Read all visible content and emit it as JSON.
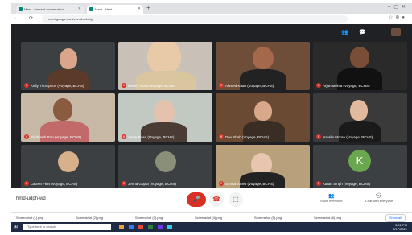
{
  "browser": {
    "tabs": [
      {
        "label": "Meet - thebard conversation",
        "active": false
      },
      {
        "label": "Meet - Meet",
        "active": true
      }
    ],
    "url": "meet.google.com/xyz-abcd-efg"
  },
  "meeting": {
    "code": "hmd-udph-wd",
    "participants": [
      {
        "name": "Kelly Thompson (Voyage, BCHS)"
      },
      {
        "name": "Kelsey Ross (Voyage, BCHS)"
      },
      {
        "name": "Ahmed Khan (Voyage, BCHS)"
      },
      {
        "name": "Arjun Mehta (Voyage, BCHS)"
      },
      {
        "name": "Siddharth Rao (Voyage, BCHS)"
      },
      {
        "name": "Avery Rose (Voyage, BCHS)"
      },
      {
        "name": "Dev Shah (Voyage, BCHS)"
      },
      {
        "name": "Natalie Moore (Voyage, BCHS)"
      },
      {
        "name": "Lauren Finn (Voyage, BCHS)"
      },
      {
        "name": "Jenna Gupta (Voyage, BCHS)"
      },
      {
        "name": "Emma Jones (Voyage, BCHS)"
      },
      {
        "name": "Karan Singh (Voyage, BCHS)",
        "initial": "K"
      }
    ],
    "controls": {
      "mic": "mic-off",
      "end": "end-call",
      "present": "present"
    },
    "side": [
      {
        "label": "Show everyone"
      },
      {
        "label": "Chat with everyone"
      }
    ]
  },
  "downloads": {
    "items": [
      "Screenshot (1).png",
      "Screenshot (2).png",
      "Screenshot (3).png",
      "Screenshot (4).png",
      "Screenshot (5).png",
      "Screenshot (6).png"
    ],
    "show_all": "Show all"
  },
  "taskbar": {
    "search_placeholder": "Type here to search",
    "time": "3:51 PM",
    "date": "3/17/2021"
  },
  "colors": {
    "meet_bg": "#202124",
    "end_red": "#d93025",
    "avatar_green": "#6aa84f"
  }
}
